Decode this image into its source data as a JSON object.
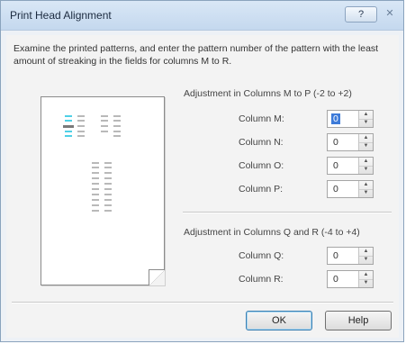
{
  "window": {
    "title": "Print Head Alignment",
    "help_label": "?",
    "close_label": "✕"
  },
  "instructions": "Examine the printed patterns, and enter the pattern number of the pattern with the least amount of streaking in the fields for columns M to R.",
  "group1": {
    "title": "Adjustment in Columns M to P (-2 to +2)",
    "fields": [
      {
        "label": "Column M:",
        "value": "0"
      },
      {
        "label": "Column N:",
        "value": "0"
      },
      {
        "label": "Column O:",
        "value": "0"
      },
      {
        "label": "Column P:",
        "value": "0"
      }
    ]
  },
  "group2": {
    "title": "Adjustment in Columns Q and R (-4 to +4)",
    "fields": [
      {
        "label": "Column Q:",
        "value": "0"
      },
      {
        "label": "Column R:",
        "value": "0"
      }
    ]
  },
  "buttons": {
    "ok": "OK",
    "help": "Help"
  },
  "colors": {
    "highlight_pattern": "#4fd0e6",
    "selection": "#3d7bd9"
  }
}
